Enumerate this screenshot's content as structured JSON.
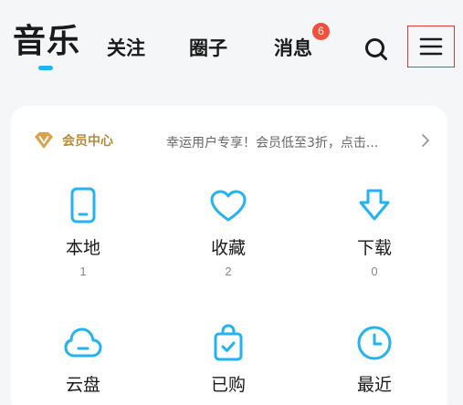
{
  "colors": {
    "accent": "#22b3f0",
    "badge": "#f0503c",
    "vip_gold": "#b58a3c",
    "highlight_box": "#e03a3a"
  },
  "nav": {
    "tabs": [
      {
        "label": "音乐",
        "active": true
      },
      {
        "label": "关注"
      },
      {
        "label": "圈子"
      },
      {
        "label": "消息",
        "badge": "6"
      }
    ],
    "search_icon": "search-icon",
    "menu_icon": "menu-icon"
  },
  "vip": {
    "icon": "vip-diamond-icon",
    "title": "会员中心",
    "promo": "幸运用户专享！会员低至3折，点击...",
    "chevron_icon": "chevron-right-icon"
  },
  "grid": [
    {
      "icon": "phone-icon",
      "label": "本地",
      "count": "1"
    },
    {
      "icon": "heart-icon",
      "label": "收藏",
      "count": "2"
    },
    {
      "icon": "download-icon",
      "label": "下载",
      "count": "0"
    },
    {
      "icon": "cloud-icon",
      "label": "云盘"
    },
    {
      "icon": "shopping-bag-icon",
      "label": "已购"
    },
    {
      "icon": "clock-icon",
      "label": "最近"
    }
  ]
}
